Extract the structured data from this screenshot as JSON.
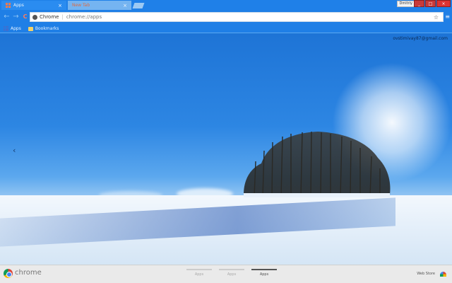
{
  "tabs": [
    {
      "label": "Apps",
      "active": true
    },
    {
      "label": "New Tab",
      "active": false
    }
  ],
  "window": {
    "profile_label": "Dmitriy",
    "minimize": "_",
    "maximize": "□",
    "close": "×"
  },
  "toolbar": {
    "back_icon": "←",
    "forward_icon": "→",
    "reload_icon": "C",
    "omnibox_scheme": "Chrome",
    "omnibox_url": "chrome://apps",
    "star_icon": "☆",
    "menu_icon": "≡"
  },
  "bookmarks": [
    {
      "label": "Apps",
      "icon": "apps-grid-icon"
    },
    {
      "label": "Bookmarks",
      "icon": "folder-icon"
    }
  ],
  "content": {
    "account_email": "ovstimivay87@gmail.com",
    "prev_page_icon": "‹"
  },
  "launcher": {
    "brand_label": "chrome",
    "pages": [
      {
        "label": "Apps",
        "active": false
      },
      {
        "label": "Apps",
        "active": false
      },
      {
        "label": "Apps",
        "active": true
      }
    ],
    "web_store_label": "Web Store"
  },
  "colors": {
    "chrome_frame": "#1f7fe6",
    "sky_top": "#1e74d6",
    "snow": "#f3f8fd"
  }
}
